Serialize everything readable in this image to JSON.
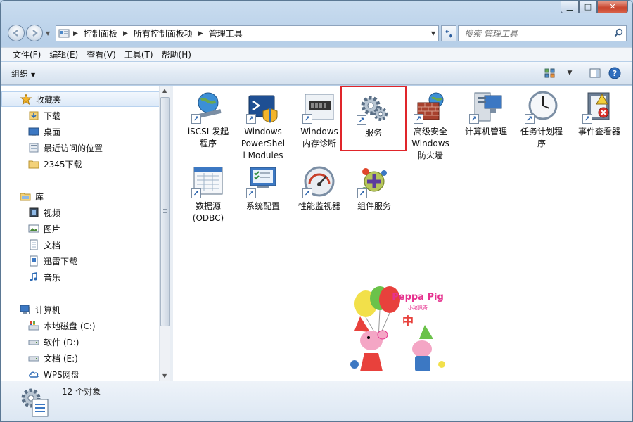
{
  "window": {
    "caption_buttons": {
      "minimize": "▁",
      "maximize": "□",
      "close": "✕"
    }
  },
  "address": {
    "crumbs": [
      "控制面板",
      "所有控制面板项",
      "管理工具"
    ],
    "search_placeholder": "搜索 管理工具"
  },
  "menu": [
    "文件(F)",
    "编辑(E)",
    "查看(V)",
    "工具(T)",
    "帮助(H)"
  ],
  "toolbar": {
    "organize_label": "组织"
  },
  "nav": {
    "favorites": {
      "label": "收藏夹",
      "items": [
        "下载",
        "桌面",
        "最近访问的位置",
        "2345下载"
      ]
    },
    "libraries": {
      "label": "库",
      "items": [
        "视频",
        "图片",
        "文档",
        "迅雷下载",
        "音乐"
      ]
    },
    "computer": {
      "label": "计算机",
      "items": [
        "本地磁盘 (C:)",
        "软件 (D:)",
        "文档 (E:)",
        "WPS网盘"
      ]
    }
  },
  "items": [
    {
      "label": "iSCSI 发起\n程序",
      "icon": "iscsi-icon"
    },
    {
      "label": "Windows\nPowerShel\nl Modules",
      "icon": "powershell-icon"
    },
    {
      "label": "Windows\n内存诊断",
      "icon": "memory-diagnostic-icon"
    },
    {
      "label": "服务",
      "icon": "services-gear-icon"
    },
    {
      "label": "高级安全\nWindows\n防火墙",
      "icon": "firewall-icon"
    },
    {
      "label": "计算机管理",
      "icon": "computer-management-icon"
    },
    {
      "label": "任务计划程\n序",
      "icon": "task-scheduler-icon"
    },
    {
      "label": "事件查看器",
      "icon": "event-viewer-icon"
    },
    {
      "label": "数据源\n(ODBC)",
      "icon": "odbc-icon"
    },
    {
      "label": "系统配置",
      "icon": "system-config-icon"
    },
    {
      "label": "性能监视器",
      "icon": "performance-monitor-icon"
    },
    {
      "label": "组件服务",
      "icon": "component-services-icon"
    }
  ],
  "peppa": {
    "logo_text": "Peppa Pig",
    "logo_sub": "小猪佩奇",
    "zhong": "中"
  },
  "status": {
    "count": "12 个对象"
  },
  "colors": {
    "highlight": "#e0252a"
  }
}
